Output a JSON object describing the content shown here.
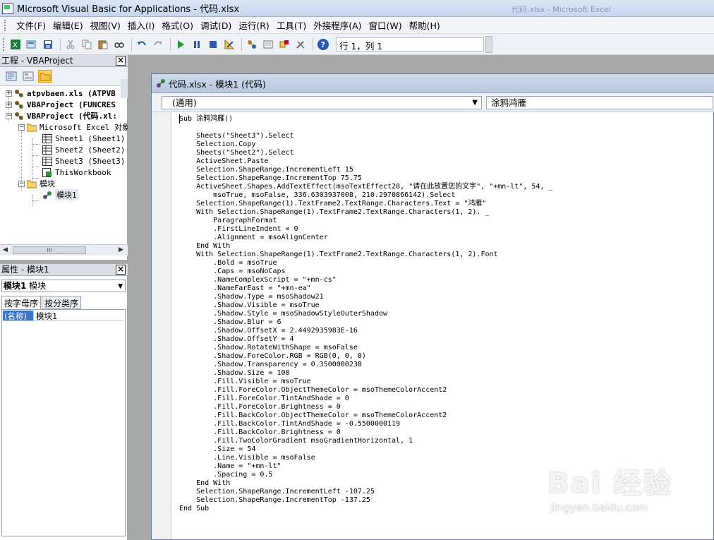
{
  "window": {
    "title": "Microsoft Visual Basic for Applications - 代码.xlsx",
    "background_title": "代码.xlsx - Microsoft Excel"
  },
  "menu": [
    "文件(F)",
    "编辑(E)",
    "视图(V)",
    "插入(I)",
    "格式(O)",
    "调试(D)",
    "运行(R)",
    "工具(T)",
    "外接程序(A)",
    "窗口(W)",
    "帮助(H)"
  ],
  "toolbar": {
    "position_text": "行 1，列 1",
    "icons": [
      "excel-icon",
      "insert-module-icon",
      "save-icon",
      "cut-icon",
      "copy-icon",
      "paste-icon",
      "find-icon",
      "undo-icon",
      "redo-icon",
      "run-icon",
      "break-icon",
      "reset-icon",
      "design-mode-icon",
      "project-explorer-icon",
      "properties-window-icon",
      "object-browser-icon",
      "toolbox-icon",
      "help-icon"
    ]
  },
  "project_panel": {
    "title": "工程 - VBAProject",
    "tree": [
      {
        "label": "atpvbaen.xls (ATPVB",
        "level": 0,
        "expander": "+",
        "bold": true
      },
      {
        "label": "VBAProject (FUNCRES",
        "level": 0,
        "expander": "+",
        "bold": true
      },
      {
        "label": "VBAProject (代码.xl:",
        "level": 0,
        "expander": "-",
        "bold": true
      },
      {
        "label": "Microsoft Excel 对象",
        "level": 1,
        "expander": "-",
        "bold": false
      },
      {
        "label": "Sheet1 (Sheet1)",
        "level": 2,
        "expander": "",
        "bold": false
      },
      {
        "label": "Sheet2 (Sheet2)",
        "level": 2,
        "expander": "",
        "bold": false
      },
      {
        "label": "Sheet3 (Sheet3)",
        "level": 2,
        "expander": "",
        "bold": false
      },
      {
        "label": "ThisWorkbook",
        "level": 2,
        "expander": "",
        "bold": false
      },
      {
        "label": "模块",
        "level": 1,
        "expander": "-",
        "bold": false
      },
      {
        "label": "模块1",
        "level": 2,
        "expander": "",
        "bold": false
      }
    ],
    "scroll_thumb": "III"
  },
  "properties_panel": {
    "title": "属性 - 模块1",
    "object_name": "模块1",
    "object_type": "模块",
    "tabs": [
      "按字母序",
      "按分类序"
    ],
    "row_key": "(名称)",
    "row_value": "模块1"
  },
  "code_window": {
    "title": "代码.xlsx - 模块1 (代码)",
    "object_combo": "(通用)",
    "proc_combo": "涂鸦鸿雁",
    "lines": [
      "Sub 涂鸦鸿雁()",
      "",
      "    Sheets(\"Sheet3\").Select",
      "    Selection.Copy",
      "    Sheets(\"Sheet2\").Select",
      "    ActiveSheet.Paste",
      "    Selection.ShapeRange.IncrementLeft 15",
      "    Selection.ShapeRange.IncrementTop 75.75",
      "    ActiveSheet.Shapes.AddTextEffect(msoTextEffect28, \"请在此放置您的文字\", \"+mn-lt\", 54, _",
      "        msoTrue, msoFalse, 336.6303937008, 210.2970866142).Select",
      "    Selection.ShapeRange(1).TextFrame2.TextRange.Characters.Text = \"鸿雁\"",
      "    With Selection.ShapeRange(1).TextFrame2.TextRange.Characters(1, 2). _",
      "        ParagraphFormat",
      "        .FirstLineIndent = 0",
      "        .Alignment = msoAlignCenter",
      "    End With",
      "    With Selection.ShapeRange(1).TextFrame2.TextRange.Characters(1, 2).Font",
      "        .Bold = msoTrue",
      "        .Caps = msoNoCaps",
      "        .NameComplexScript = \"+mn-cs\"",
      "        .NameFarEast = \"+mn-ea\"",
      "        .Shadow.Type = msoShadow21",
      "        .Shadow.Visible = msoTrue",
      "        .Shadow.Style = msoShadowStyleOuterShadow",
      "        .Shadow.Blur = 6",
      "        .Shadow.OffsetX = 2.4492935983E-16",
      "        .Shadow.OffsetY = 4",
      "        .Shadow.RotateWithShape = msoFalse",
      "        .Shadow.ForeColor.RGB = RGB(0, 0, 0)",
      "        .Shadow.Transparency = 0.3500000238",
      "        .Shadow.Size = 100",
      "        .Fill.Visible = msoTrue",
      "        .Fill.ForeColor.ObjectThemeColor = msoThemeColorAccent2",
      "        .Fill.ForeColor.TintAndShade = 0",
      "        .Fill.ForeColor.Brightness = 0",
      "        .Fill.BackColor.ObjectThemeColor = msoThemeColorAccent2",
      "        .Fill.BackColor.TintAndShade = -0.5500000119",
      "        .Fill.BackColor.Brightness = 0",
      "        .Fill.TwoColorGradient msoGradientHorizontal, 1",
      "        .Size = 54",
      "        .Line.Visible = msoFalse",
      "        .Name = \"+mn-lt\"",
      "        .Spacing = 0.5",
      "    End With",
      "    Selection.ShapeRange.IncrementLeft -107.25",
      "    Selection.ShapeRange.IncrementTop -137.25",
      "End Sub"
    ]
  },
  "watermark": {
    "brand": "Bai 经验",
    "url": "jingyan.baidu.com"
  }
}
